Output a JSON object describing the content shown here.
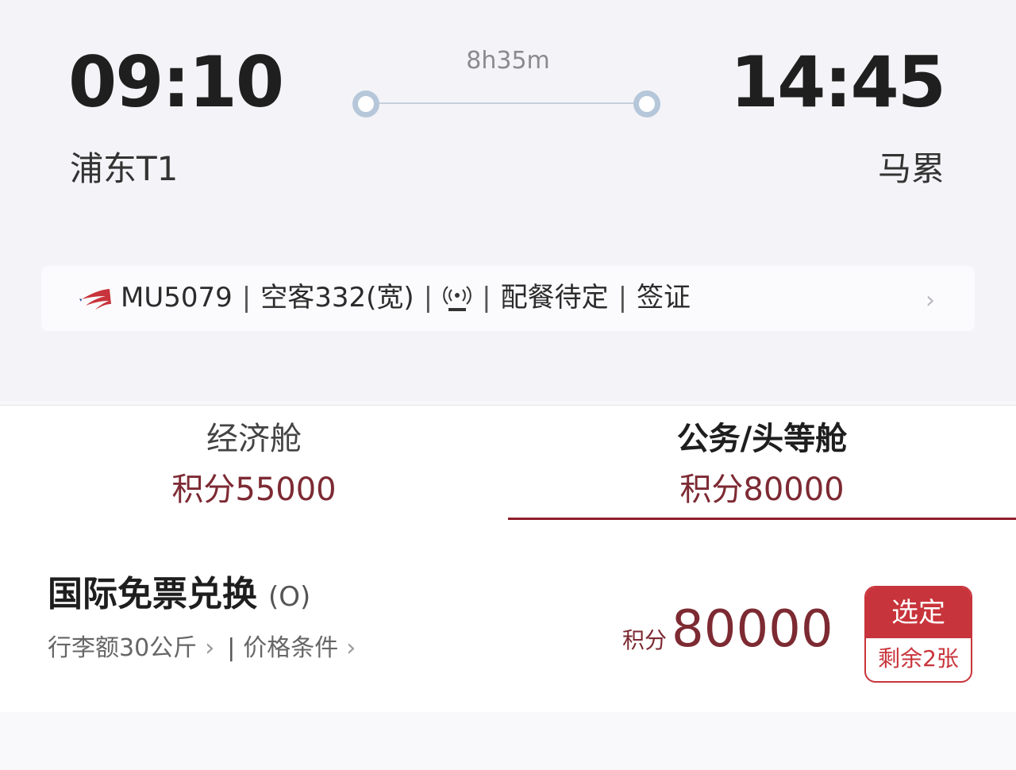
{
  "flight": {
    "departure_time": "09:10",
    "arrival_time": "14:45",
    "departure_airport": "浦东T1",
    "arrival_airport": "马累",
    "duration": "8h35m"
  },
  "info_bar": {
    "flight_no": "MU5079",
    "aircraft": "空客332(宽)",
    "wifi_icon": "wifi-icon",
    "meal": "配餐待定",
    "visa": "签证",
    "separator": "|",
    "chevron": "›"
  },
  "tabs": [
    {
      "name": "经济舱",
      "points": "积分55000",
      "selected": false
    },
    {
      "name": "公务/头等舱",
      "points": "积分80000",
      "selected": true
    }
  ],
  "fare": {
    "title": "国际免票兑换",
    "code": "(O)",
    "baggage": "行李额30公斤",
    "conditions": "价格条件",
    "chevron": "›",
    "separator": "|",
    "price_label": "积分",
    "price_value": "80000",
    "select_label": "选定",
    "remaining": "剩余2张"
  },
  "colors": {
    "accent_red": "#c8343b",
    "points_color": "#7d2a33",
    "tab_underline": "#8f1e2a"
  }
}
